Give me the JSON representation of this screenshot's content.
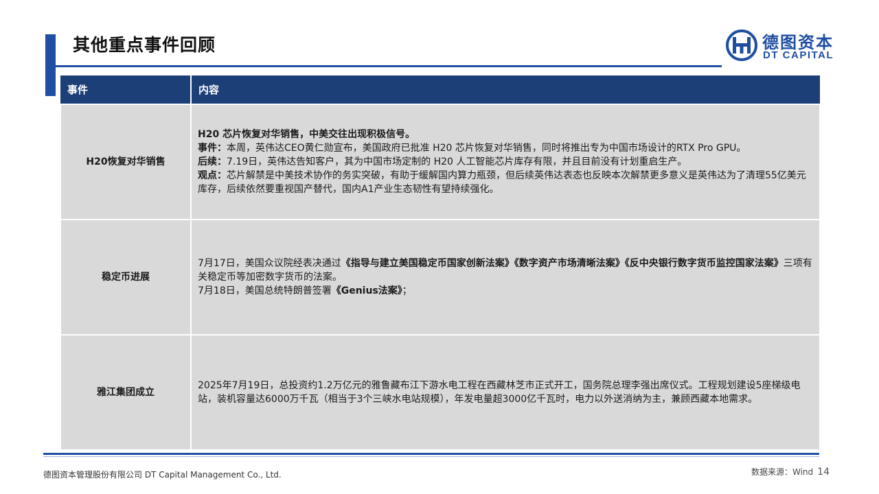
{
  "slide": {
    "title": "其他重点事件回顾",
    "page_number": "14"
  },
  "logo": {
    "name_cn": "德图资本",
    "name_en": "DT CAPITAL",
    "color": "#1f4ea3"
  },
  "table": {
    "headers": [
      "事件",
      "内容"
    ],
    "rows": [
      {
        "event": "H20恢复对华销售",
        "lead": "H20 芯片恢复对华销售，中美交往出现积极信号。",
        "items": [
          {
            "label": "事件：",
            "text": "本周，英伟达CEO黄仁勋宣布，美国政府已批准 H20 芯片恢复对华销售，同时将推出专为中国市场设计的RTX Pro GPU。"
          },
          {
            "label": "后续：",
            "text": "7.19日，英伟达告知客户，其为中国市场定制的 H20 人工智能芯片库存有限，并且目前没有计划重启生产。"
          },
          {
            "label": "观点：",
            "text": "芯片解禁是中美技术协作的务实突破，有助于缓解国内算力瓶颈，但后续英伟达表态也反映本次解禁更多意义是英伟达为了清理55亿美元库存，后续依然要重视国产替代，国内A1产业生态韧性有望持续强化。"
          }
        ]
      },
      {
        "event": "稳定币进展",
        "p1_prefix": "7月17日，美国众议院经表决通过",
        "p1_bold": "《指导与建立美国稳定币国家创新法案》《数字资产市场清晰法案》《反中央银行数字货币监控国家法案》",
        "p1_suffix": "三项有关稳定币等加密数字货币的法案。",
        "p2_prefix": "7月18日，美国总统特朗普签署",
        "p2_bold": "《Genius法案》",
        "p2_suffix": "；"
      },
      {
        "event": "雅江集团成立",
        "content": "2025年7月19日，总投资约1.2万亿元的雅鲁藏布江下游水电工程在西藏林芝市正式开工，国务院总理李强出席仪式。工程规划建设5座梯级电站，装机容量达6000万千瓦（相当于3个三峡水电站规模），年发电量超3000亿千瓦时，电力以外送消纳为主，兼顾西藏本地需求。"
      }
    ]
  },
  "footer": {
    "company": "德图资本管理股份有限公司 DT Capital Management Co., Ltd.",
    "source": "数据来源：Wind"
  },
  "colors": {
    "accent": "#1f4ea3",
    "header_bg": "#1c3f78",
    "cell_bg": "#d9d9d9"
  }
}
